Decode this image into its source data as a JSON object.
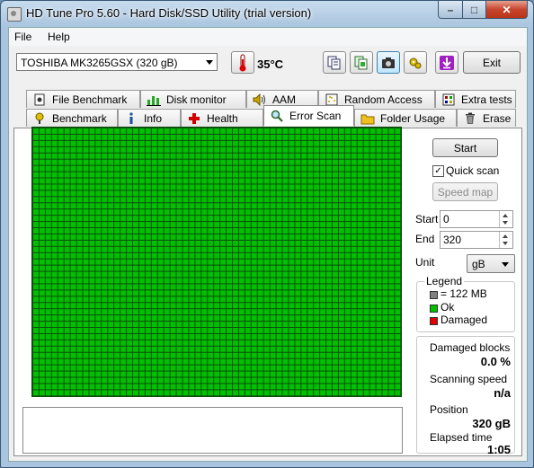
{
  "window": {
    "title": "HD Tune Pro 5.60 - Hard Disk/SSD Utility (trial version)"
  },
  "menu": {
    "file": "File",
    "help": "Help"
  },
  "toolbar": {
    "drive": "TOSHIBA MK3265GSX (320 gB)",
    "temperature": "35°C",
    "exit_label": "Exit"
  },
  "tabs_top": [
    {
      "label": "File Benchmark",
      "icon": "file-benchmark-icon"
    },
    {
      "label": "Disk monitor",
      "icon": "disk-monitor-icon"
    },
    {
      "label": "AAM",
      "icon": "speaker-icon"
    },
    {
      "label": "Random Access",
      "icon": "random-access-icon"
    },
    {
      "label": "Extra tests",
      "icon": "extra-tests-icon"
    }
  ],
  "tabs_bottom": [
    {
      "label": "Benchmark",
      "icon": "benchmark-icon"
    },
    {
      "label": "Info",
      "icon": "info-icon"
    },
    {
      "label": "Health",
      "icon": "health-icon"
    },
    {
      "label": "Error Scan",
      "icon": "magnifier-icon",
      "active": true
    },
    {
      "label": "Folder Usage",
      "icon": "folder-icon"
    },
    {
      "label": "Erase",
      "icon": "trash-icon"
    }
  ],
  "scan": {
    "start_button": "Start",
    "quick_scan_label": "Quick scan",
    "quick_scan_checked": true,
    "speed_map_button": "Speed map",
    "start_label": "Start",
    "start_value": "0",
    "end_label": "End",
    "end_value": "320",
    "unit_label": "Unit",
    "unit_value": "gB"
  },
  "legend": {
    "title": "Legend",
    "block_size": "= 122 MB",
    "ok": "Ok",
    "damaged": "Damaged",
    "colors": {
      "block": "#808080",
      "ok": "#00c000",
      "damaged": "#e00000"
    }
  },
  "stats": {
    "damaged_blocks_label": "Damaged blocks",
    "damaged_blocks_value": "0.0 %",
    "scanning_speed_label": "Scanning speed",
    "scanning_speed_value": "n/a",
    "position_label": "Position",
    "position_value": "320 gB",
    "elapsed_label": "Elapsed time",
    "elapsed_value": "1:05"
  }
}
